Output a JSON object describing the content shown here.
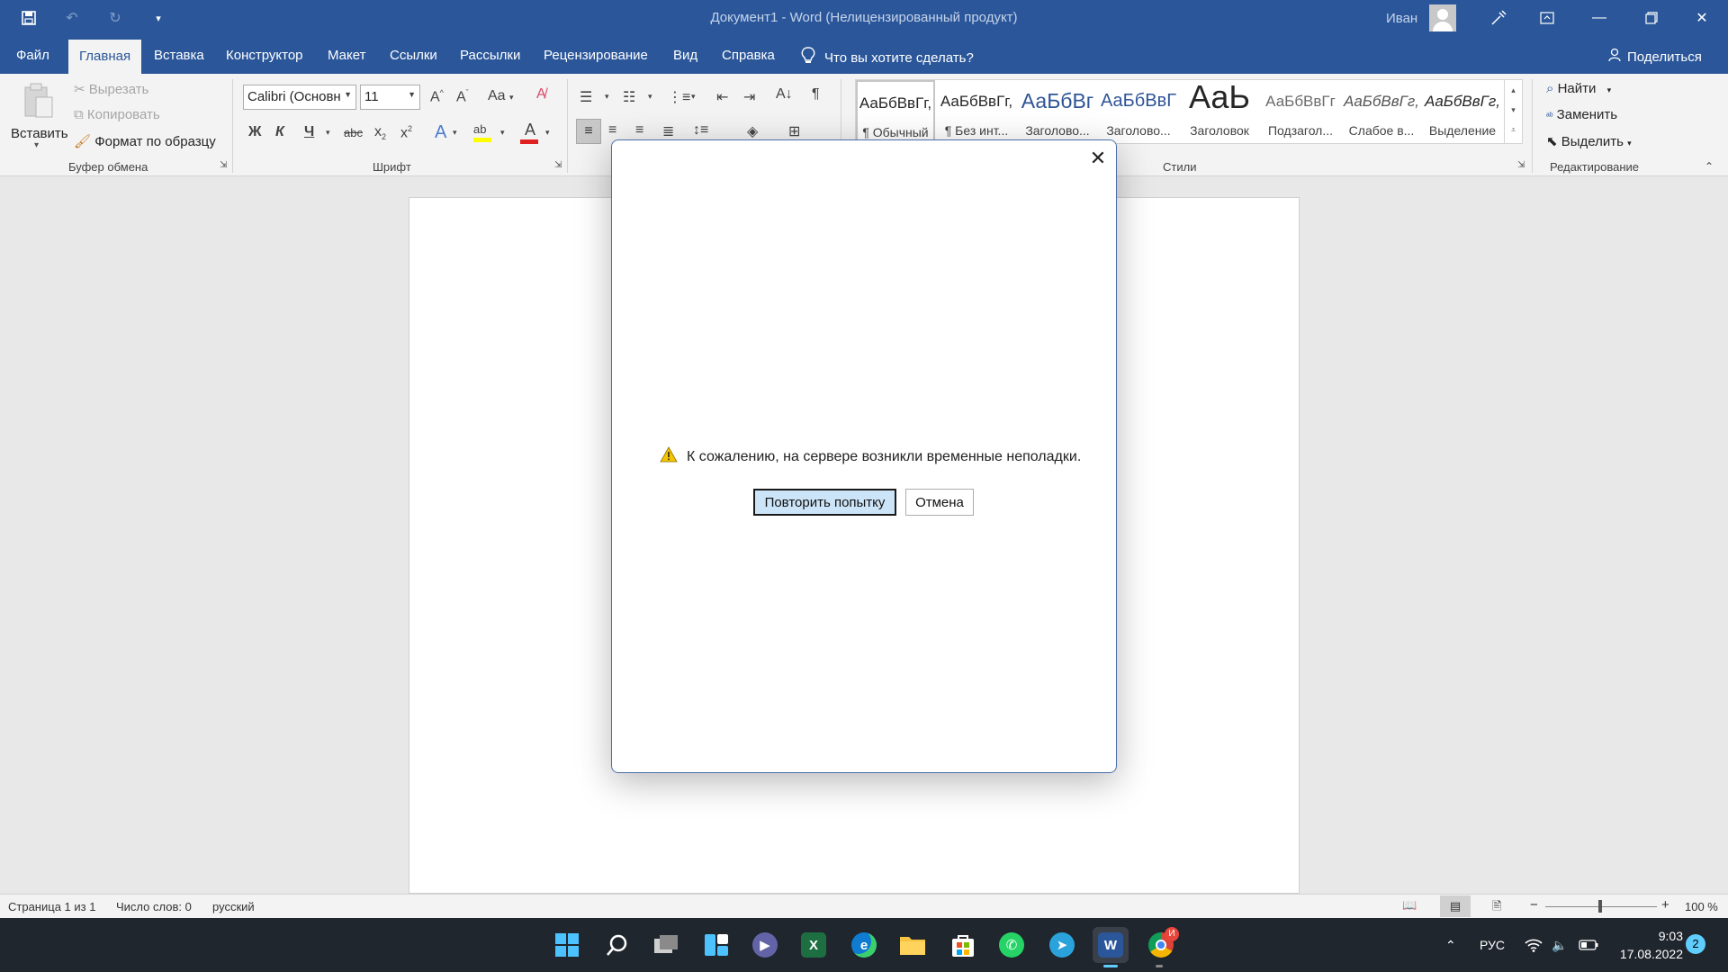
{
  "window": {
    "title": "Документ1  -  Word (Нелицензированный продукт)",
    "user_name": "Иван"
  },
  "tabs": [
    "Файл",
    "Главная",
    "Вставка",
    "Конструктор",
    "Макет",
    "Ссылки",
    "Рассылки",
    "Рецензирование",
    "Вид",
    "Справка"
  ],
  "tell_me": "Что вы хотите сделать?",
  "share": "Поделиться",
  "ribbon": {
    "clipboard": {
      "paste": "Вставить",
      "cut": "Вырезать",
      "copy": "Копировать",
      "format_painter": "Формат по образцу",
      "group": "Буфер обмена"
    },
    "font": {
      "font_name": "Calibri (Основн",
      "font_size": "11",
      "group": "Шрифт",
      "bold": "Ж",
      "italic": "К",
      "underline": "Ч",
      "strike": "abc",
      "change_case": "Aa"
    },
    "styles": {
      "items": [
        {
          "sample": "АаБбВвГг,",
          "name": "¶ Обычный"
        },
        {
          "sample": "АаБбВвГг,",
          "name": "¶ Без инт..."
        },
        {
          "sample": "АаБбВг",
          "name": "Заголово..."
        },
        {
          "sample": "АаБбВвГ",
          "name": "Заголово..."
        },
        {
          "sample": "АаЬ",
          "name": "Заголовок"
        },
        {
          "sample": "АаБбВвГг",
          "name": "Подзагол..."
        },
        {
          "sample": "АаБбВвГг,",
          "name": "Слабое в..."
        },
        {
          "sample": "АаБбВвГг,",
          "name": "Выделение"
        }
      ],
      "group": "Стили"
    },
    "editing": {
      "find": "Найти",
      "replace": "Заменить",
      "select": "Выделить",
      "group": "Редактирование"
    }
  },
  "dialog": {
    "message": "К сожалению, на сервере возникли временные неполадки.",
    "retry": "Повторить попытку",
    "cancel": "Отмена"
  },
  "status": {
    "page": "Страница 1 из 1",
    "words": "Число слов: 0",
    "language": "русский",
    "zoom": "100 %",
    "zoom_percent": 100
  },
  "taskbar": {
    "lang": "РУС",
    "time": "9:03",
    "date": "17.08.2022",
    "notifications": "2",
    "chrome_badge": "И"
  }
}
